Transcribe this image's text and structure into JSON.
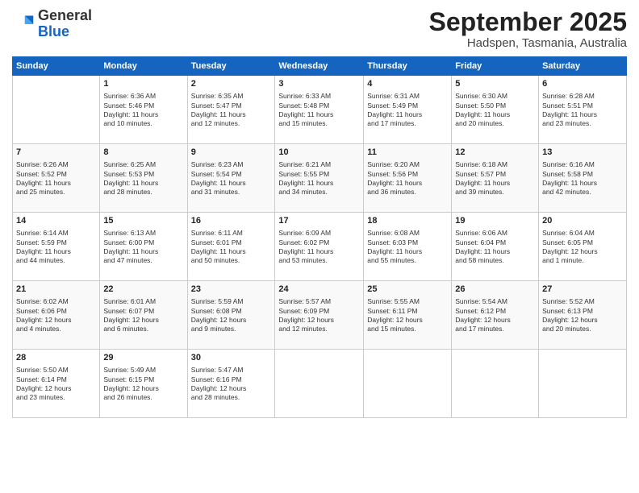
{
  "logo": {
    "general": "General",
    "blue": "Blue"
  },
  "title": "September 2025",
  "location": "Hadspen, Tasmania, Australia",
  "days_header": [
    "Sunday",
    "Monday",
    "Tuesday",
    "Wednesday",
    "Thursday",
    "Friday",
    "Saturday"
  ],
  "weeks": [
    [
      {
        "num": "",
        "info": ""
      },
      {
        "num": "1",
        "info": "Sunrise: 6:36 AM\nSunset: 5:46 PM\nDaylight: 11 hours\nand 10 minutes."
      },
      {
        "num": "2",
        "info": "Sunrise: 6:35 AM\nSunset: 5:47 PM\nDaylight: 11 hours\nand 12 minutes."
      },
      {
        "num": "3",
        "info": "Sunrise: 6:33 AM\nSunset: 5:48 PM\nDaylight: 11 hours\nand 15 minutes."
      },
      {
        "num": "4",
        "info": "Sunrise: 6:31 AM\nSunset: 5:49 PM\nDaylight: 11 hours\nand 17 minutes."
      },
      {
        "num": "5",
        "info": "Sunrise: 6:30 AM\nSunset: 5:50 PM\nDaylight: 11 hours\nand 20 minutes."
      },
      {
        "num": "6",
        "info": "Sunrise: 6:28 AM\nSunset: 5:51 PM\nDaylight: 11 hours\nand 23 minutes."
      }
    ],
    [
      {
        "num": "7",
        "info": "Sunrise: 6:26 AM\nSunset: 5:52 PM\nDaylight: 11 hours\nand 25 minutes."
      },
      {
        "num": "8",
        "info": "Sunrise: 6:25 AM\nSunset: 5:53 PM\nDaylight: 11 hours\nand 28 minutes."
      },
      {
        "num": "9",
        "info": "Sunrise: 6:23 AM\nSunset: 5:54 PM\nDaylight: 11 hours\nand 31 minutes."
      },
      {
        "num": "10",
        "info": "Sunrise: 6:21 AM\nSunset: 5:55 PM\nDaylight: 11 hours\nand 34 minutes."
      },
      {
        "num": "11",
        "info": "Sunrise: 6:20 AM\nSunset: 5:56 PM\nDaylight: 11 hours\nand 36 minutes."
      },
      {
        "num": "12",
        "info": "Sunrise: 6:18 AM\nSunset: 5:57 PM\nDaylight: 11 hours\nand 39 minutes."
      },
      {
        "num": "13",
        "info": "Sunrise: 6:16 AM\nSunset: 5:58 PM\nDaylight: 11 hours\nand 42 minutes."
      }
    ],
    [
      {
        "num": "14",
        "info": "Sunrise: 6:14 AM\nSunset: 5:59 PM\nDaylight: 11 hours\nand 44 minutes."
      },
      {
        "num": "15",
        "info": "Sunrise: 6:13 AM\nSunset: 6:00 PM\nDaylight: 11 hours\nand 47 minutes."
      },
      {
        "num": "16",
        "info": "Sunrise: 6:11 AM\nSunset: 6:01 PM\nDaylight: 11 hours\nand 50 minutes."
      },
      {
        "num": "17",
        "info": "Sunrise: 6:09 AM\nSunset: 6:02 PM\nDaylight: 11 hours\nand 53 minutes."
      },
      {
        "num": "18",
        "info": "Sunrise: 6:08 AM\nSunset: 6:03 PM\nDaylight: 11 hours\nand 55 minutes."
      },
      {
        "num": "19",
        "info": "Sunrise: 6:06 AM\nSunset: 6:04 PM\nDaylight: 11 hours\nand 58 minutes."
      },
      {
        "num": "20",
        "info": "Sunrise: 6:04 AM\nSunset: 6:05 PM\nDaylight: 12 hours\nand 1 minute."
      }
    ],
    [
      {
        "num": "21",
        "info": "Sunrise: 6:02 AM\nSunset: 6:06 PM\nDaylight: 12 hours\nand 4 minutes."
      },
      {
        "num": "22",
        "info": "Sunrise: 6:01 AM\nSunset: 6:07 PM\nDaylight: 12 hours\nand 6 minutes."
      },
      {
        "num": "23",
        "info": "Sunrise: 5:59 AM\nSunset: 6:08 PM\nDaylight: 12 hours\nand 9 minutes."
      },
      {
        "num": "24",
        "info": "Sunrise: 5:57 AM\nSunset: 6:09 PM\nDaylight: 12 hours\nand 12 minutes."
      },
      {
        "num": "25",
        "info": "Sunrise: 5:55 AM\nSunset: 6:11 PM\nDaylight: 12 hours\nand 15 minutes."
      },
      {
        "num": "26",
        "info": "Sunrise: 5:54 AM\nSunset: 6:12 PM\nDaylight: 12 hours\nand 17 minutes."
      },
      {
        "num": "27",
        "info": "Sunrise: 5:52 AM\nSunset: 6:13 PM\nDaylight: 12 hours\nand 20 minutes."
      }
    ],
    [
      {
        "num": "28",
        "info": "Sunrise: 5:50 AM\nSunset: 6:14 PM\nDaylight: 12 hours\nand 23 minutes."
      },
      {
        "num": "29",
        "info": "Sunrise: 5:49 AM\nSunset: 6:15 PM\nDaylight: 12 hours\nand 26 minutes."
      },
      {
        "num": "30",
        "info": "Sunrise: 5:47 AM\nSunset: 6:16 PM\nDaylight: 12 hours\nand 28 minutes."
      },
      {
        "num": "",
        "info": ""
      },
      {
        "num": "",
        "info": ""
      },
      {
        "num": "",
        "info": ""
      },
      {
        "num": "",
        "info": ""
      }
    ]
  ]
}
